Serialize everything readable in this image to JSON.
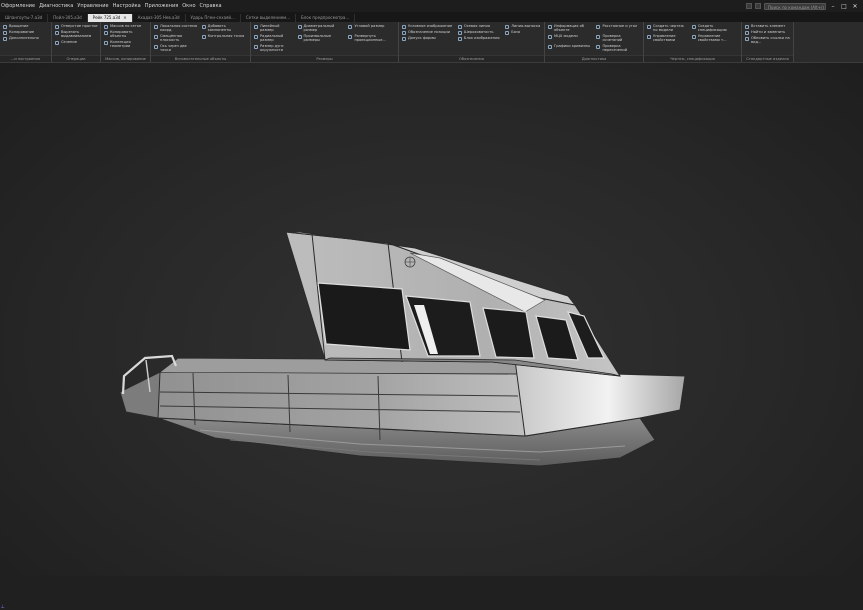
{
  "menu": {
    "items": [
      "Оформление",
      "Диагностика",
      "Управление",
      "Настройка",
      "Приложения",
      "Окно",
      "Справка"
    ],
    "search_placeholder": "Поиск по командам (Alt+/)"
  },
  "tabs": [
    {
      "label": "Шпангоуты-7.a3d",
      "active": false
    },
    {
      "label": "Пойл-305.a3d",
      "active": false
    },
    {
      "label": "Рейк 725.a3d",
      "active": true
    },
    {
      "label": "Ахадаз-305 Нев.a3d",
      "active": false
    },
    {
      "label": "Ударь Пгмн-сехаяй...",
      "active": false
    },
    {
      "label": "Сетки выделением...",
      "active": false
    },
    {
      "label": "Блок предпросмотра...",
      "active": false
    }
  ],
  "ribbon": {
    "groups": [
      {
        "label": "...и построения",
        "items": [
          "Вращение",
          "Копирование",
          "Дополнительно"
        ]
      },
      {
        "label": "Операции",
        "items": [
          "Отверстие простое",
          "Вырезать выдавливанием",
          "Сечение"
        ]
      },
      {
        "label": "Массив, копирование",
        "items": [
          "Массив по сетке",
          "Копировать объекты",
          "Коллекция геометрии"
        ]
      },
      {
        "label": "Вспомогательные объекты",
        "items": [
          "Локальная система коорд.",
          "Смещённая плоскость",
          "Ось через две точки",
          "Добавить компоненты",
          "Контрольная точка"
        ]
      },
      {
        "label": "Размеры",
        "items": [
          "Линейный размер",
          "Радиальный размер",
          "Размер дуги окружности",
          "Диаметральный размер",
          "Произвольные размеры",
          "Угловой размер",
          "Развернуть проекционные..."
        ]
      },
      {
        "label": "Обозначения",
        "items": [
          "Условное изображение",
          "Обозначение позиции",
          "Допуск формы",
          "Осевая линия",
          "Шероховатость",
          "База",
          "Линия-выноска",
          "Блок изображения"
        ]
      },
      {
        "label": "Диагностика",
        "items": [
          "Информация об объекте",
          "МЦХ модели",
          "Графики кривизны",
          "Расстояние и угол",
          "Проверка сочетаний",
          "Проверка пересечений"
        ]
      },
      {
        "label": "Чертеж, спецификация",
        "items": [
          "Создать чертеж по модели",
          "Управление свойствами",
          "Создать спецификацию",
          "Управление свойствами т..."
        ]
      },
      {
        "label": "Стандартные изделия",
        "items": [
          "Вставить элемент",
          "Найти и заменить",
          "Обновить ссылки на вид..."
        ]
      }
    ]
  },
  "colors": {
    "viewport_bg": "#2b2b2b",
    "ribbon_bg": "#2b2b2b",
    "active_tab_bg": "#e6e6e6",
    "hull_light": "#d4d4d4",
    "hull_dark": "#7a7a7a"
  }
}
